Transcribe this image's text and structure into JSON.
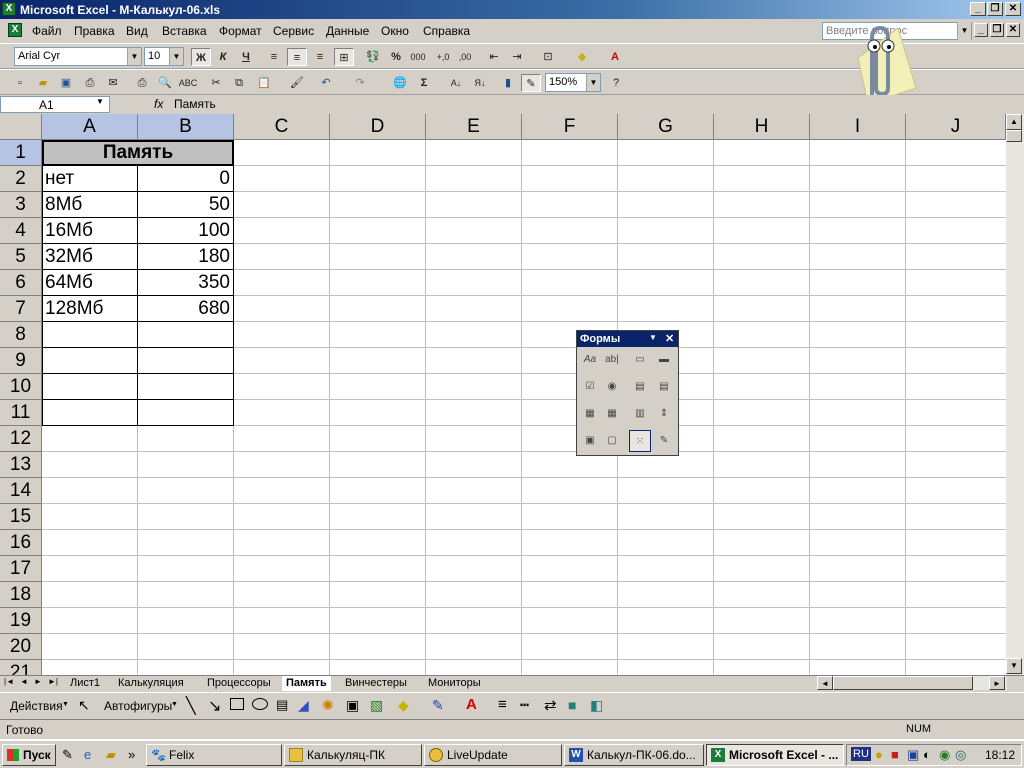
{
  "title": "Microsoft Excel - М-Калькул-06.xls",
  "menu": [
    "Файл",
    "Правка",
    "Вид",
    "Вставка",
    "Формат",
    "Сервис",
    "Данные",
    "Окно",
    "Справка"
  ],
  "help_placeholder": "Введите вопрос",
  "format_bar": {
    "font": "Arial Cyr",
    "size": "10",
    "bold": "Ж",
    "italic": "К",
    "underline": "Ч",
    "percent": "%",
    "thousands": "000"
  },
  "standard_bar": {
    "zoom": "150%",
    "sigma": "Σ"
  },
  "formula_bar": {
    "cell_ref": "A1",
    "fx": "fx",
    "value": "Память"
  },
  "columns": [
    "A",
    "B",
    "C",
    "D",
    "E",
    "F",
    "G",
    "H",
    "I",
    "J"
  ],
  "rows": [
    "1",
    "2",
    "3",
    "4",
    "5",
    "6",
    "7",
    "8",
    "9",
    "10",
    "11",
    "12",
    "13",
    "14",
    "15",
    "16",
    "17",
    "18",
    "19",
    "20",
    "21"
  ],
  "table": {
    "header": "Память",
    "rows": [
      {
        "label": "нет",
        "value": "0"
      },
      {
        "label": "8Мб",
        "value": "50"
      },
      {
        "label": "16Мб",
        "value": "100"
      },
      {
        "label": "32Мб",
        "value": "180"
      },
      {
        "label": "64Мб",
        "value": "350"
      },
      {
        "label": "128Мб",
        "value": "680"
      }
    ]
  },
  "sheet_tabs": [
    "Лист1",
    "Калькуляция",
    "Процессоры",
    "Память",
    "Винчестеры",
    "Мониторы"
  ],
  "active_sheet": "Память",
  "draw_bar": {
    "actions": "Действия",
    "autoshapes": "Автофигуры"
  },
  "forms_palette": {
    "title": "Формы"
  },
  "status": {
    "left": "Готово",
    "num": "NUM"
  },
  "taskbar": {
    "start": "Пуск",
    "tasks": [
      "Felix",
      "Калькуляц-ПК",
      "LiveUpdate",
      "Калькул-ПК-06.do...",
      "Microsoft Excel - ..."
    ],
    "lang": "RU",
    "clock": "18:12"
  },
  "colors": {
    "title_start": "#0a246a",
    "selection": "#b6c4e4",
    "excel_green": "#1c7c3c"
  }
}
